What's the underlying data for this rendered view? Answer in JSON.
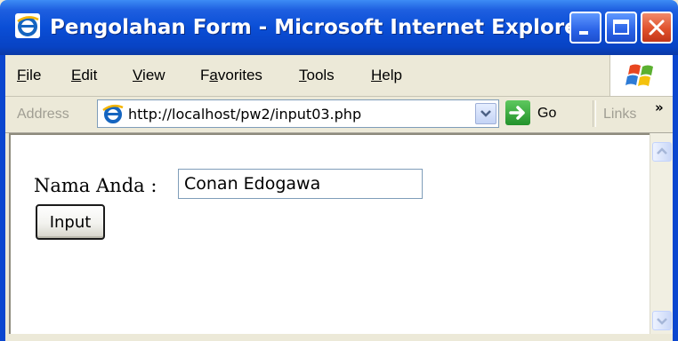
{
  "window": {
    "title": "Pengolahan Form - Microsoft Internet Explorer"
  },
  "menu": {
    "items": [
      {
        "first": "F",
        "rest": "ile"
      },
      {
        "first": "E",
        "rest": "dit"
      },
      {
        "first": "V",
        "rest": "iew"
      },
      {
        "pre": "F",
        "first": "a",
        "rest": "vorites"
      },
      {
        "first": "T",
        "rest": "ools"
      },
      {
        "first": "H",
        "rest": "elp"
      }
    ]
  },
  "address_bar": {
    "label": "Address",
    "url": "http://localhost/pw2/input03.php",
    "go_label": "Go",
    "links_label": "Links"
  },
  "form": {
    "label": "Nama Anda :",
    "input_value": "Conan Edogawa",
    "submit_label": "Input"
  },
  "colors": {
    "title_bar": "#0a4ed6",
    "chrome": "#ece9d8",
    "close_button": "#e0512c",
    "go_arrow": "#23922b"
  },
  "icons": {
    "app": "ie-logo-icon",
    "minimize": "minimize-icon",
    "maximize": "maximize-icon",
    "close": "close-icon",
    "windows_logo": "windows-logo-icon",
    "dropdown": "chevron-down-icon",
    "go": "arrow-right-icon",
    "links_more": "chevron-double-right-icon",
    "scroll_up": "chevron-up-icon",
    "scroll_down": "chevron-down-icon"
  }
}
